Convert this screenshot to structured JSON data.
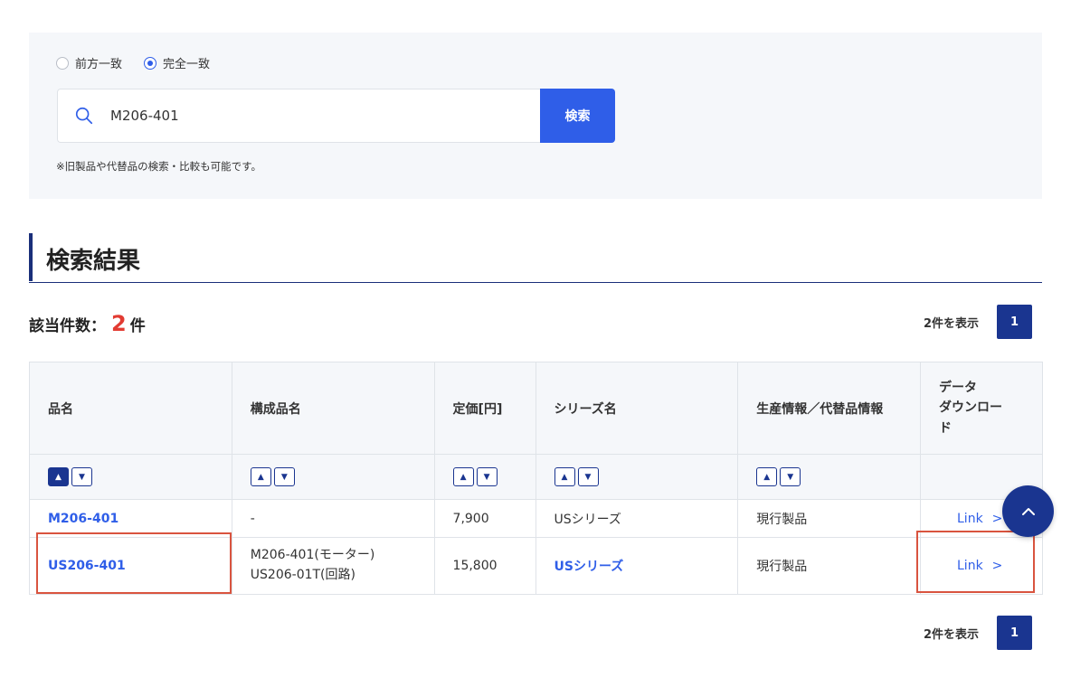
{
  "search": {
    "mode_options": [
      "前方一致",
      "完全一致"
    ],
    "selected_mode": "完全一致",
    "query": "M206-401",
    "button_label": "検索",
    "note": "※旧製品や代替品の検索・比較も可能です。"
  },
  "results": {
    "title": "検索結果",
    "count_label": "該当件数：",
    "count": "2",
    "count_unit": "件",
    "pager_text": "2件を表示",
    "current_page": "1"
  },
  "table": {
    "headers": {
      "name": "品名",
      "component": "構成品名",
      "price": "定価[円]",
      "series": "シリーズ名",
      "status": "生産情報／代替品情報",
      "download_line1": "データ",
      "download_line2": "ダウンロー",
      "download_line3": "ド"
    },
    "rows": [
      {
        "name": "M206-401",
        "component_line1": "-",
        "component_line2": "",
        "price": "7,900",
        "series": "USシリーズ",
        "status": "現行製品",
        "download": "Link"
      },
      {
        "name": "US206-401",
        "component_line1": "M206-401(モーター)",
        "component_line2": "US206-01T(回路)",
        "price": "15,800",
        "series": "USシリーズ",
        "status": "現行製品",
        "download": "Link"
      }
    ]
  },
  "icons": {
    "search": "search-icon",
    "sort_up": "sort-up-icon",
    "sort_down": "sort-down-icon",
    "chevron_right": "chevron-right-icon",
    "chevron_up": "chevron-up-icon"
  },
  "colors": {
    "accent_blue": "#2f5ee8",
    "navy": "#1a3590",
    "count_red": "#e23b32",
    "highlight_red": "#d9543f"
  }
}
